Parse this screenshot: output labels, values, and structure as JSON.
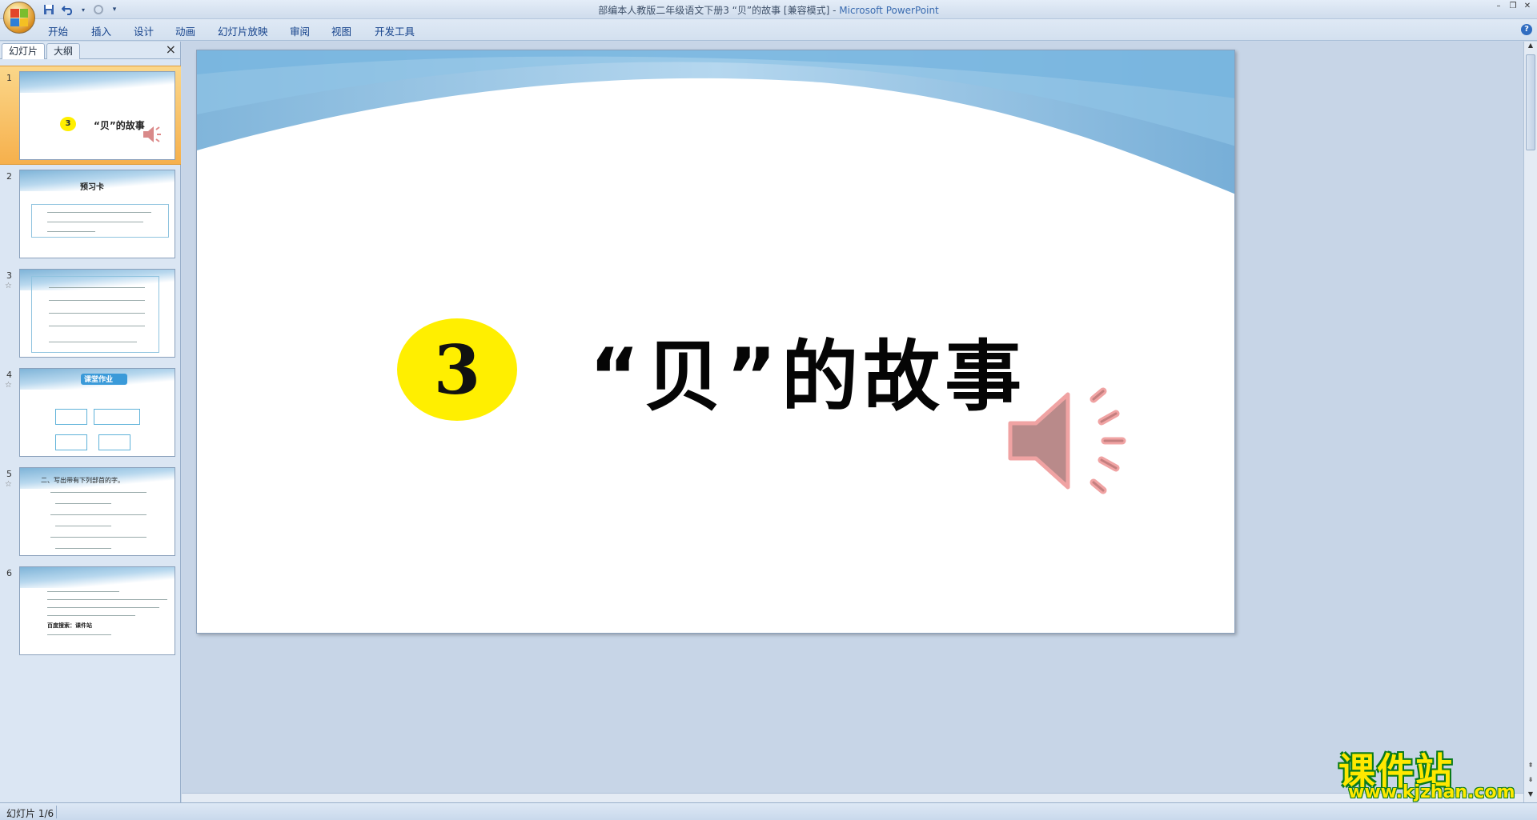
{
  "window": {
    "title_doc": "部编本人教版二年级语文下册3 “贝”的故事 [兼容模式]",
    "title_sep": " - ",
    "title_app": "Microsoft PowerPoint"
  },
  "ribbon": {
    "tabs": [
      "开始",
      "插入",
      "设计",
      "动画",
      "幻灯片放映",
      "审阅",
      "视图",
      "开发工具"
    ]
  },
  "left_pane": {
    "tab_slides": "幻灯片",
    "tab_outline": "大纲",
    "close": "×",
    "thumbnails": [
      {
        "num": "1",
        "title": "“贝”的故事",
        "badge": "3",
        "selected": true
      },
      {
        "num": "2",
        "title": "预习卡"
      },
      {
        "num": "3",
        "title": ""
      },
      {
        "num": "4",
        "title": "课堂作业"
      },
      {
        "num": "5",
        "title": "二、写出带有下列部首的字。"
      },
      {
        "num": "6",
        "title": "百度搜索：课件站"
      }
    ]
  },
  "slide": {
    "number_badge": "3",
    "title": "“贝”的故事",
    "badge_color": "#ffef00"
  },
  "status": {
    "slide_indicator": "幻灯片 1/6"
  },
  "watermark": {
    "logo_text": "课件站",
    "url": "www.kjzhan.com"
  }
}
